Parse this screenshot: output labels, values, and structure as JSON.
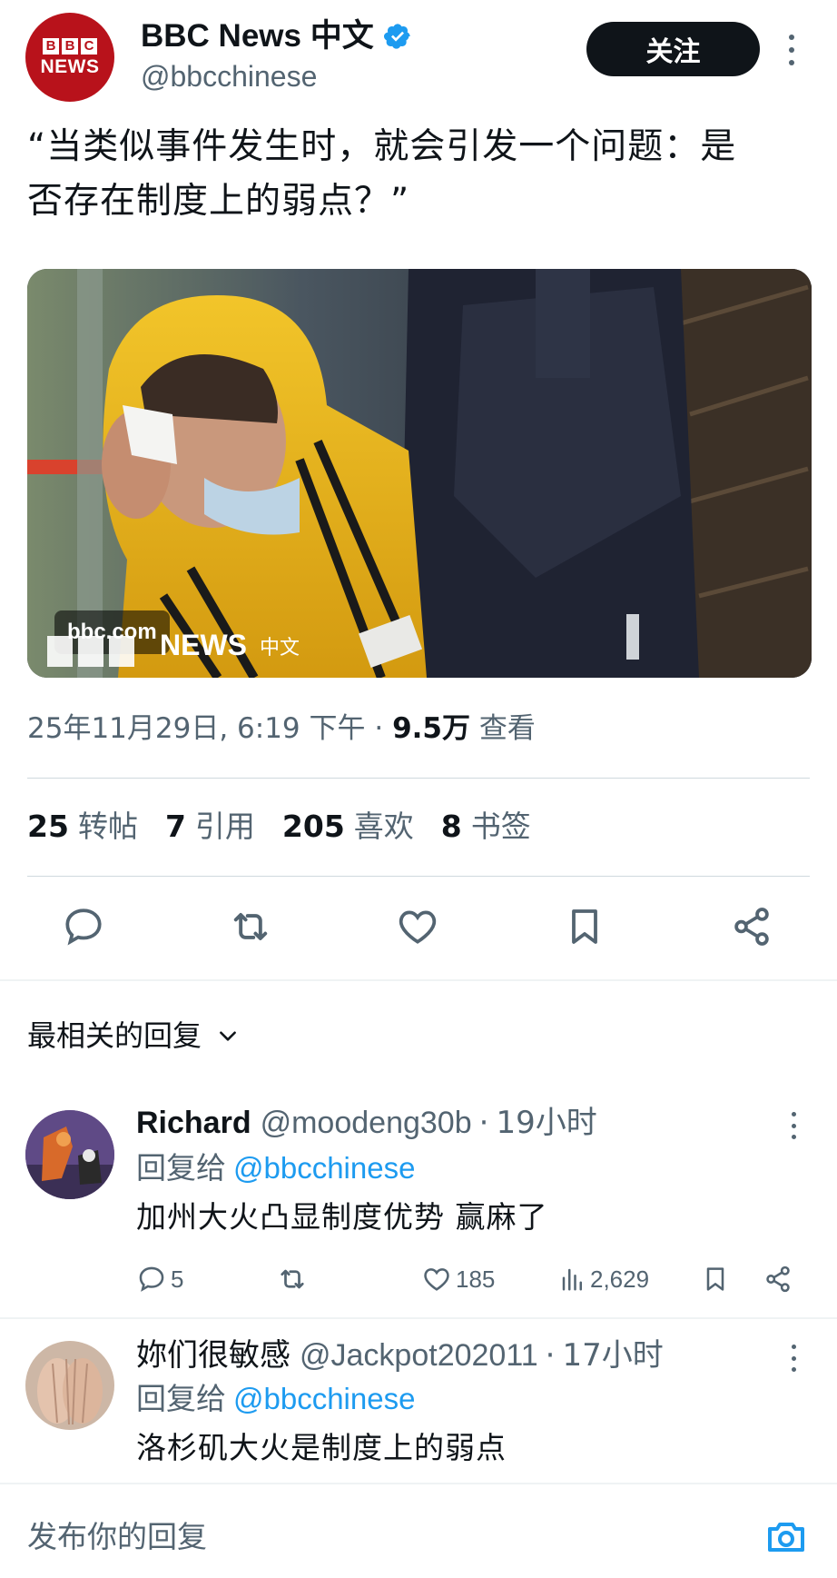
{
  "tweet": {
    "display_name": "BBC News 中文",
    "handle": "@bbcchinese",
    "follow_label": "关注",
    "text_line1": "“当类似事件发生时，就会引发一个问题：是",
    "text_line2": "否存在制度上的弱点？”",
    "image_caption": "bbc.com",
    "image_logo_letters": [
      "B",
      "B",
      "C"
    ],
    "image_logo_text": "NEWS",
    "image_logo_zh": "中文",
    "avatar_letters": [
      "B",
      "B",
      "C"
    ],
    "avatar_text": "NEWS",
    "date_time": "25年11月29日, 6:19 下午 · ",
    "views_count": "9.5万",
    "views_label": " 查看"
  },
  "stats": [
    {
      "num": "25",
      "label": "转帖"
    },
    {
      "num": "7",
      "label": "引用"
    },
    {
      "num": "205",
      "label": "喜欢"
    },
    {
      "num": "8",
      "label": "书签"
    }
  ],
  "action_icons": [
    "reply-icon",
    "retweet-icon",
    "like-icon",
    "bookmark-icon",
    "share-icon"
  ],
  "replies_section": {
    "sort_label": "最相关的回复"
  },
  "replies": [
    {
      "name": "Richard",
      "handle": "@moodeng30b",
      "sep": "·",
      "time": "19小时",
      "reply_to_label": "回复给",
      "reply_to_handle": "@bbcchinese",
      "text": "加州大火凸显制度优势 赢麻了",
      "reply_count": "5",
      "retweet_count": "",
      "like_count": "185",
      "view_count": "2,629"
    },
    {
      "name": "妳们很敏感",
      "handle": "@Jackpot202011",
      "sep": "·",
      "time": "17小时",
      "reply_to_label": "回复给",
      "reply_to_handle": "@bbcchinese",
      "text": "洛杉矶大火是制度上的弱点"
    }
  ],
  "compose": {
    "placeholder": "发布你的回复"
  },
  "colors": {
    "accent": "#1d9bf0",
    "text_primary": "#0f1419",
    "text_secondary": "#536471",
    "bbc_red": "#b8121b"
  }
}
